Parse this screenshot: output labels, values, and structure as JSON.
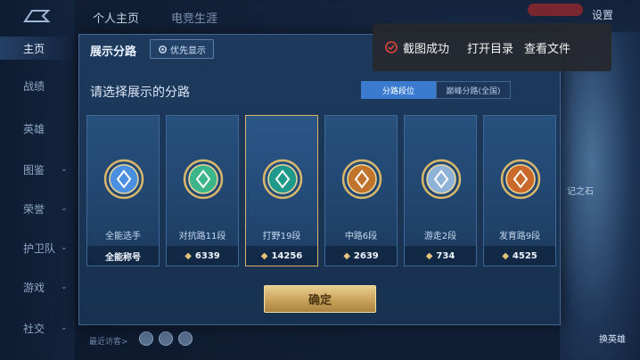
{
  "nav": {
    "tabs": [
      "个人主页",
      "电竞生涯"
    ],
    "settings_label": "设置"
  },
  "sidebar": {
    "items": [
      {
        "label": "主页",
        "active": true,
        "chevron": false
      },
      {
        "label": "战绩",
        "active": false,
        "chevron": false
      },
      {
        "label": "英雄",
        "active": false,
        "chevron": false
      },
      {
        "label": "图鉴",
        "active": false,
        "chevron": true
      },
      {
        "label": "荣誉",
        "active": false,
        "chevron": true
      },
      {
        "label": "护卫队",
        "active": false,
        "chevron": true
      },
      {
        "label": "游戏",
        "active": false,
        "chevron": true
      },
      {
        "label": "社交",
        "active": false,
        "chevron": true
      }
    ]
  },
  "dialog": {
    "title": "展示分路",
    "priority_button": "优先显示",
    "prompt": "请选择展示的分路",
    "segments": {
      "active": "分路段位",
      "inactive": "巅峰分路(全国)"
    },
    "cards": [
      {
        "name": "全能选手",
        "value": "全能称号",
        "show_diamond": false,
        "emblem_color": "#4a8fe0",
        "selected": false
      },
      {
        "name": "对抗路11段",
        "value": "6339",
        "show_diamond": true,
        "emblem_color": "#3bb58a",
        "selected": false
      },
      {
        "name": "打野19段",
        "value": "14256",
        "show_diamond": true,
        "emblem_color": "#1f9a8a",
        "selected": true
      },
      {
        "name": "中路6段",
        "value": "2639",
        "show_diamond": true,
        "emblem_color": "#c0742c",
        "selected": false
      },
      {
        "name": "游走2段",
        "value": "734",
        "show_diamond": true,
        "emblem_color": "#8fb2d8",
        "selected": false
      },
      {
        "name": "发育路9段",
        "value": "4525",
        "show_diamond": true,
        "emblem_color": "#c96a2a",
        "selected": false
      }
    ],
    "confirm_label": "确定"
  },
  "toast": {
    "message": "截图成功",
    "action_open_dir": "打开目录",
    "action_view_file": "查看文件"
  },
  "background": {
    "visitors_label": "最近访客>",
    "art_label": "记之石",
    "hero_label": "换英雄"
  },
  "colors": {
    "accent_gold": "#d8b469",
    "segment_active": "#3a7bd0",
    "toast_ok": "#e0453a"
  }
}
